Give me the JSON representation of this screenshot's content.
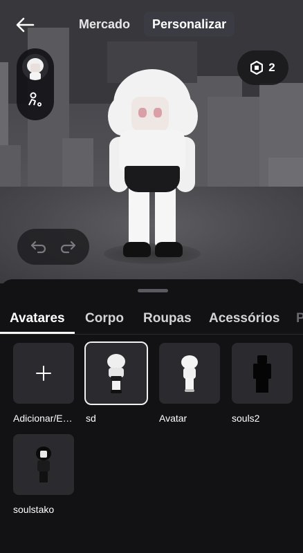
{
  "header": {
    "back_icon": "arrow-left-icon",
    "tabs": [
      {
        "label": "Mercado",
        "active": false
      },
      {
        "label": "Personalizar",
        "active": true
      }
    ]
  },
  "robux": {
    "icon": "robux-hexagon-icon",
    "count": "2"
  },
  "side_controls": {
    "avatar_icon": "current-avatar-thumbnail",
    "settings_icon": "avatar-settings-icon"
  },
  "undo_redo": {
    "undo_icon": "undo-icon",
    "redo_icon": "redo-icon"
  },
  "categories": [
    {
      "label": "Avatares",
      "active": true
    },
    {
      "label": "Corpo",
      "active": false
    },
    {
      "label": "Roupas",
      "active": false
    },
    {
      "label": "Acessórios",
      "active": false
    },
    {
      "label": "P",
      "active": false
    }
  ],
  "avatars": [
    {
      "label": "Adicionar/E…",
      "icon": "plus-icon",
      "selected": false
    },
    {
      "label": "sd",
      "selected": true
    },
    {
      "label": "Avatar",
      "selected": false
    },
    {
      "label": "souls2",
      "selected": false
    },
    {
      "label": "soulstako",
      "selected": false
    }
  ],
  "colors": {
    "background": "#121215",
    "tile": "#2a2a2f",
    "accent": "#ffffff"
  }
}
